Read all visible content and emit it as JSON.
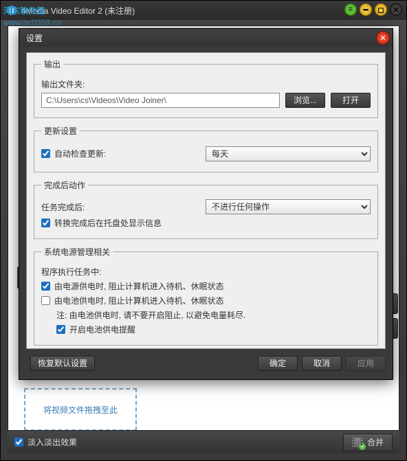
{
  "app": {
    "title": "4Media Video Editor 2 (未注册)"
  },
  "watermark": {
    "text": "河东软件园",
    "url": "www.pc0359.cn"
  },
  "dialog": {
    "title": "设置",
    "output": {
      "legend": "输出",
      "folder_label": "输出文件夹:",
      "folder_value": "C:\\Users\\cs\\Videos\\Video Joiner\\",
      "browse": "浏览...",
      "open": "打开"
    },
    "update": {
      "legend": "更新设置",
      "auto_check": "自动检查更新:",
      "frequency": "每天"
    },
    "after": {
      "legend": "完成后动作",
      "task_done_label": "任务完成后:",
      "task_done_value": "不进行任何操作",
      "tray_msg": "转换完成后在托盘处显示信息"
    },
    "power": {
      "legend": "系统电源管理相关",
      "running_label": "程序执行任务中:",
      "ac_block": "由电源供电时, 阻止计算机进入待机、休眠状态",
      "batt_block": "由电池供电时, 阻止计算机进入待机、休眠状态",
      "note": "注: 由电池供电时, 请不要开启阻止, 以避免电量耗尽.",
      "batt_remind": "开启电池供电提醒"
    },
    "footer": {
      "restore": "恢复默认设置",
      "ok": "确定",
      "cancel": "取消",
      "apply": "应用"
    }
  },
  "dropzone": {
    "text": "将视频文件拖拽至此"
  },
  "bottombar": {
    "fade": "淡入淡出效果",
    "merge": "合并"
  }
}
